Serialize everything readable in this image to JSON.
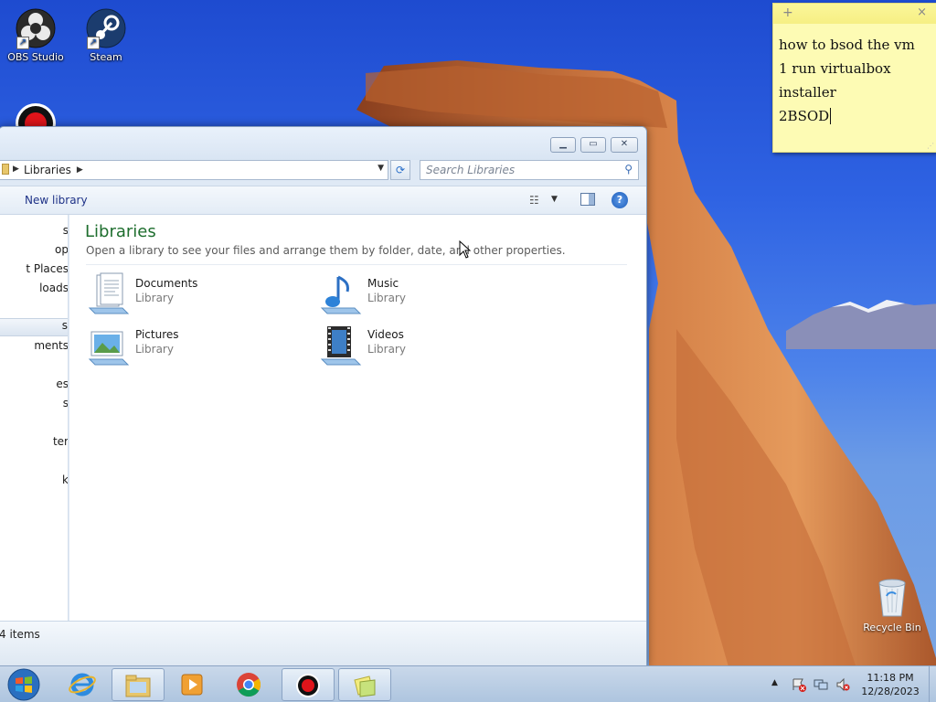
{
  "desktop": {
    "icons": [
      {
        "label": "OBS Studio",
        "icon": "obs-icon"
      },
      {
        "label": "Steam",
        "icon": "steam-icon"
      },
      {
        "label": "Recycle Bin",
        "icon": "recycle-bin-icon"
      }
    ]
  },
  "sticky_note": {
    "lines": [
      "how to bsod the vm",
      "1 run virtualbox",
      "installer",
      "2BSOD"
    ]
  },
  "explorer": {
    "address": {
      "crumb": "Libraries"
    },
    "search_placeholder": "Search Libraries",
    "toolbar": {
      "new_library": "New library"
    },
    "nav_items": [
      "s",
      "op",
      "t Places",
      "loads",
      "s",
      "ments",
      "es",
      "s",
      "ter",
      "k"
    ],
    "content": {
      "title": "Libraries",
      "description": "Open a library to see your files and arrange them by folder, date, and other properties.",
      "libraries": [
        {
          "name": "Documents",
          "kind": "Library"
        },
        {
          "name": "Music",
          "kind": "Library"
        },
        {
          "name": "Pictures",
          "kind": "Library"
        },
        {
          "name": "Videos",
          "kind": "Library"
        }
      ]
    },
    "status": "4 items"
  },
  "taskbar": {
    "clock_time": "11:18 PM",
    "clock_date": "12/28/2023"
  },
  "colors": {
    "library_title": "#1e6e2e",
    "sticky_bg": "#fdfbb4",
    "taskbar": "#bccfe5"
  }
}
